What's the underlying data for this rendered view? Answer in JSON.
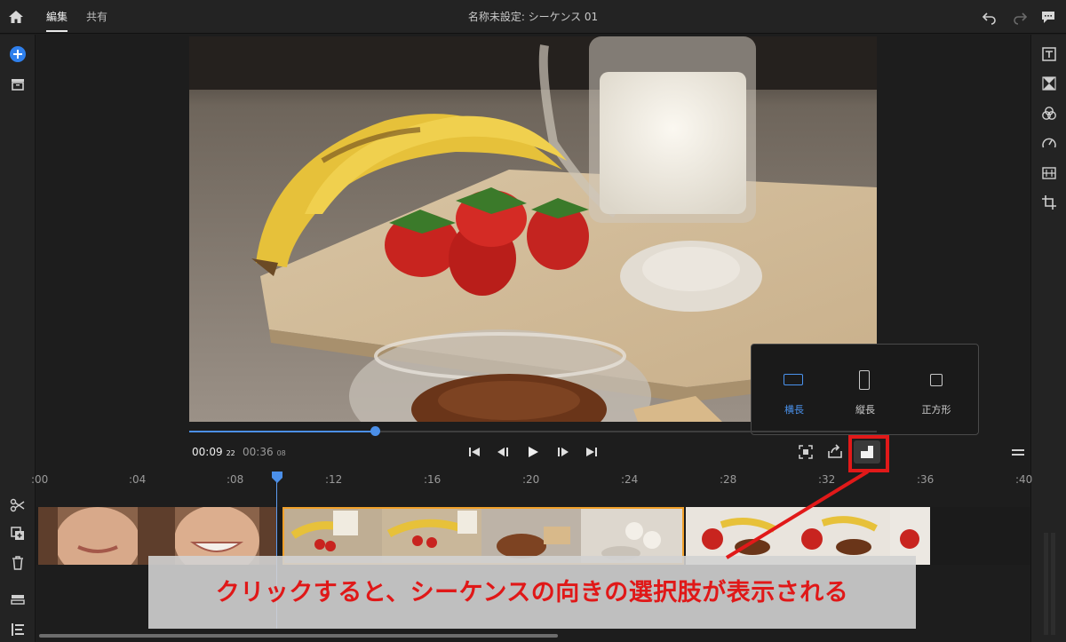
{
  "header": {
    "tabs": [
      {
        "label": "編集",
        "active": true
      },
      {
        "label": "共有",
        "active": false
      }
    ],
    "title": "名称未設定: シーケンス 01"
  },
  "left_toolbar": {
    "icons": [
      "add-icon",
      "media-bin-icon",
      "scissors-icon",
      "duplicate-icon",
      "trash-icon",
      "track-height-icon",
      "list-icon"
    ]
  },
  "right_toolbar": {
    "icons": [
      "titles-icon",
      "transitions-icon",
      "color-icon",
      "speed-icon",
      "audio-icon",
      "crop-icon"
    ]
  },
  "playback": {
    "current_time": "00:09",
    "current_frame": "22",
    "duration": "00:36",
    "duration_frame": "08",
    "progress": 0.27
  },
  "orientation_menu": {
    "options": [
      {
        "label": "横長",
        "selected": true
      },
      {
        "label": "縦長",
        "selected": false
      },
      {
        "label": "正方形",
        "selected": false
      }
    ]
  },
  "timeline": {
    "ticks": [
      ":00",
      ":04",
      ":08",
      ":12",
      ":16",
      ":20",
      ":24",
      ":28",
      ":32",
      ":36",
      ":40"
    ]
  },
  "annotation": {
    "text": "クリックすると、シーケンスの向きの選択肢が表示される"
  },
  "colors": {
    "accent": "#4b8fe8",
    "clip_selected_border": "#f2a12a",
    "annotation_red": "#e01818"
  }
}
